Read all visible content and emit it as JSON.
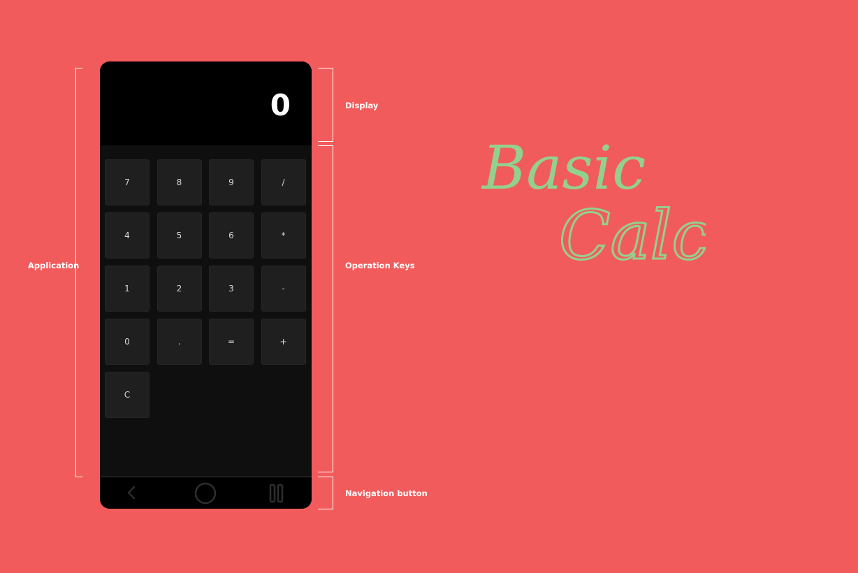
{
  "display": {
    "value": "0"
  },
  "keypad": {
    "keys": [
      "7",
      "8",
      "9",
      "/",
      "4",
      "5",
      "6",
      "*",
      "1",
      "2",
      "3",
      "-",
      "0",
      ".",
      "=",
      "+",
      "C"
    ]
  },
  "navigation": {
    "back_icon": "chevron-left-icon",
    "home_icon": "circle-home-icon",
    "recents_icon": "recents-icon"
  },
  "annotations": {
    "application": "Application",
    "display": "Display",
    "operation_keys": "Operation Keys",
    "navigation_button": "Navigation button"
  },
  "logo": {
    "line1": "Basic",
    "line2": "Calc",
    "color": "#93d08f"
  },
  "colors": {
    "background": "#f25b5b",
    "phone": "#0f0f0f",
    "display": "#000000",
    "key": "#1f1f1f",
    "key_text": "#d8d8d8",
    "annotation": "#ffffff"
  }
}
